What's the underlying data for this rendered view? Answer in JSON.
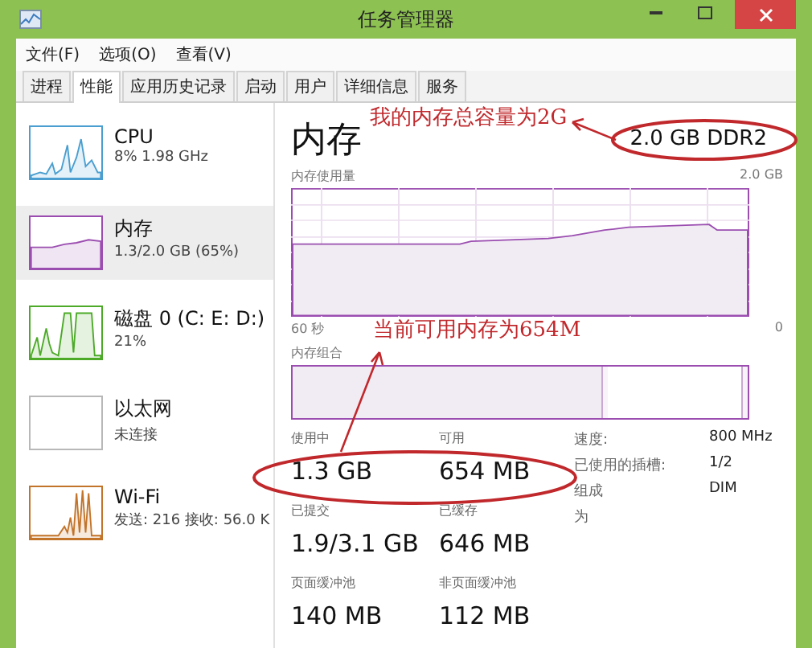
{
  "window": {
    "title": "任务管理器"
  },
  "menu": [
    "文件(F)",
    "选项(O)",
    "查看(V)"
  ],
  "tabs": [
    {
      "label": "进程",
      "selected": false
    },
    {
      "label": "性能",
      "selected": true
    },
    {
      "label": "应用历史记录",
      "selected": false
    },
    {
      "label": "启动",
      "selected": false
    },
    {
      "label": "用户",
      "selected": false
    },
    {
      "label": "详细信息",
      "selected": false
    },
    {
      "label": "服务",
      "selected": false
    }
  ],
  "sidebar": {
    "items": [
      {
        "kind": "cpu",
        "name": "CPU",
        "detail": "8% 1.98 GHz",
        "selected": false,
        "color": "#4a9fd0"
      },
      {
        "kind": "memory",
        "name": "内存",
        "detail": "1.3/2.0 GB (65%)",
        "selected": true,
        "color": "#9b4eb0"
      },
      {
        "kind": "disk",
        "name": "磁盘 0 (C: E: D:)",
        "detail": "21%",
        "selected": false,
        "color": "#4caa28"
      },
      {
        "kind": "ethernet",
        "name": "以太网",
        "detail": "未连接",
        "selected": false,
        "color": "#b8b8b8"
      },
      {
        "kind": "wifi",
        "name": "Wi-Fi",
        "detail": "发送: 216 接收: 56.0 K",
        "selected": false,
        "color": "#c2742a"
      }
    ]
  },
  "main": {
    "title": "内存",
    "capacity": "2.0 GB DDR2",
    "usage_graph": {
      "label": "内存使用量",
      "max": "2.0 GB",
      "x_start": "60 秒",
      "x_end": "0"
    },
    "composition": {
      "label": "内存组合"
    },
    "stats": [
      [
        {
          "label": "使用中",
          "value": "1.3 GB"
        },
        {
          "label": "可用",
          "value": "654 MB"
        }
      ],
      [
        {
          "label": "已提交",
          "value": "1.9/3.1 GB"
        },
        {
          "label": "已缓存",
          "value": "646 MB"
        }
      ],
      [
        {
          "label": "页面缓冲池",
          "value": "140 MB"
        },
        {
          "label": "非页面缓冲池",
          "value": "112 MB"
        }
      ]
    ],
    "details": [
      {
        "label": "速度:",
        "value": "800 MHz"
      },
      {
        "label": "已使用的插槽:",
        "value": "1/2"
      },
      {
        "label": "组成",
        "value": "DIM"
      },
      {
        "label": "为"
      }
    ]
  },
  "annotations": [
    {
      "text": "我的内存总容量为2G"
    },
    {
      "text": "当前可用内存为654M"
    }
  ]
}
